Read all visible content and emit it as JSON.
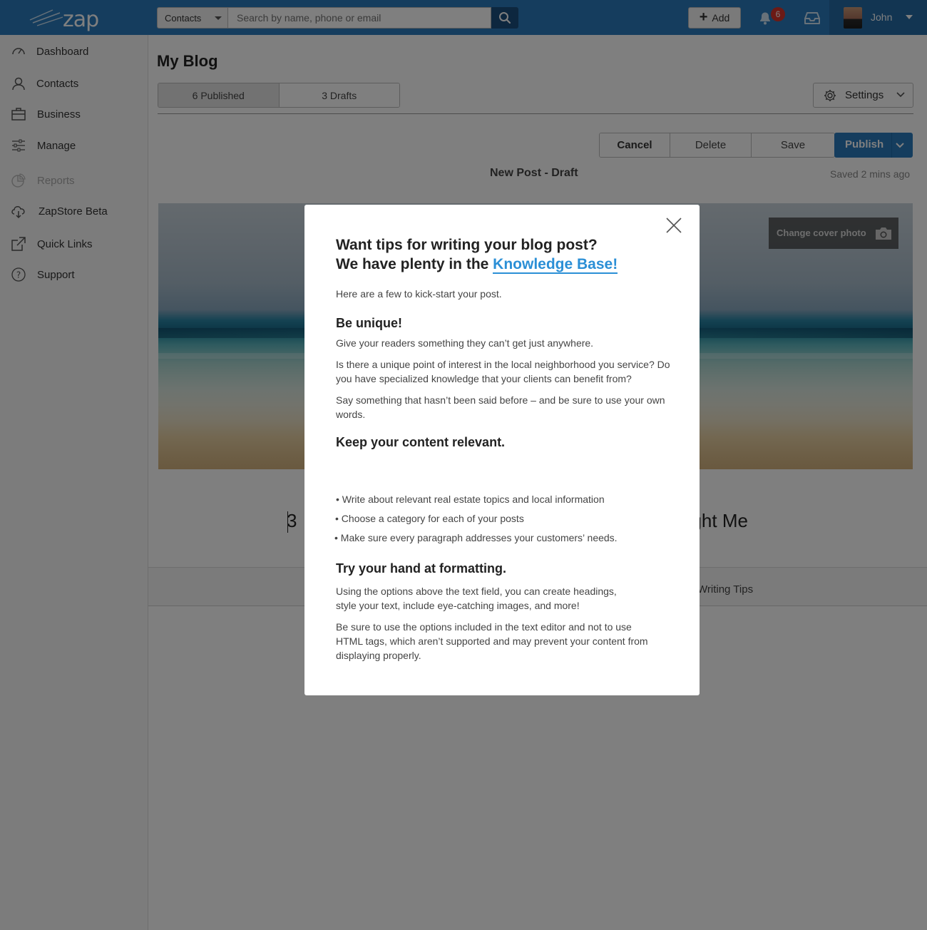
{
  "topbar": {
    "logo_text": "zap",
    "search_scope": "Contacts",
    "search_placeholder": "Search by name, phone or email",
    "add_label": "Add",
    "notifications_count": "6",
    "user_name": "John",
    "colors": {
      "bar": "#2b7bbd",
      "badge": "#d9342b"
    }
  },
  "sidebar": {
    "items": [
      {
        "label": "Dashboard",
        "icon": "dashboard-gauge-icon"
      },
      {
        "label": "Contacts",
        "icon": "person-icon"
      },
      {
        "label": "Business",
        "icon": "briefcase-icon"
      },
      {
        "label": "Manage",
        "icon": "sliders-icon"
      },
      {
        "label": "Reports",
        "icon": "pie-chart-icon",
        "disabled": true
      },
      {
        "label": "ZapStore Beta",
        "icon": "cloud-download-icon"
      },
      {
        "label": "Quick Links",
        "icon": "external-link-icon"
      },
      {
        "label": "Support",
        "icon": "question-circle-icon"
      }
    ]
  },
  "main": {
    "page_title": "My Blog",
    "tabs": [
      {
        "label": "6 Published",
        "active": true
      },
      {
        "label": "3 Drafts",
        "active": false
      }
    ],
    "settings_label": "Settings",
    "actions": {
      "cancel": "Cancel",
      "delete": "Delete",
      "save": "Save",
      "publish": "Publish"
    },
    "post_status": "New Post - Draft",
    "saved_ago": "Saved 2 mins ago",
    "change_cover": "Change cover photo",
    "post_title_left": "3",
    "post_title_right": "ught Me",
    "writing_tips": "Writing Tips"
  },
  "modal": {
    "heading_line1": "Want tips for writing your blog post?",
    "heading_line2_prefix": "We have plenty in the ",
    "heading_link": "Knowledge Base!",
    "intro": "Here are a few to kick-start your post.",
    "section1_title": "Be unique!",
    "section1_p1": "Give your readers something they can’t get just anywhere.",
    "section1_p2": "Is there a unique point of interest in the local neighborhood you service? Do you have specialized knowledge that your clients can benefit from?",
    "section1_p3": "Say something that hasn’t been said before – and be sure to use your own words.",
    "section2_title": "Keep your content relevant.",
    "bullets": [
      "• Write about relevant real estate topics and local information",
      "• Choose a category for each of your posts",
      "• Make sure every paragraph addresses your customers’ needs."
    ],
    "section3_title": "Try your hand at formatting.",
    "section3_p1": "Using the options above the text field, you can create headings, style your text, include eye-catching images, and more!",
    "section3_p2": "Be sure to use the options included in the text editor and not to use HTML tags, which aren’t supported and may prevent your content from displaying properly.",
    "link_color": "#2b8fd6"
  }
}
